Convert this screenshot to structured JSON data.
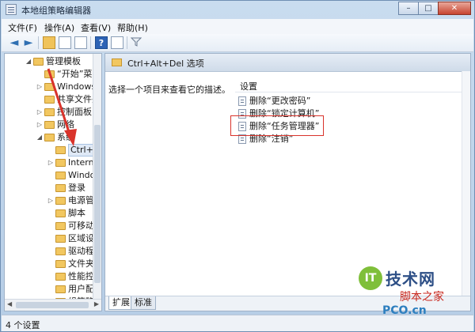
{
  "window": {
    "title": "本地组策略编辑器",
    "minimize": "–",
    "maximize": "□",
    "close": "✕"
  },
  "menu": [
    "文件(F)",
    "操作(A)",
    "查看(V)",
    "帮助(H)"
  ],
  "toolbar": {
    "back": "◄",
    "forward": "►",
    "help": "?"
  },
  "tree": [
    {
      "label": "管理模板",
      "exp": "◢"
    },
    {
      "label": "“开始”菜",
      "exp": ""
    },
    {
      "label": "Windows",
      "exp": "▷"
    },
    {
      "label": "共享文件夹",
      "exp": ""
    },
    {
      "label": "控制面板",
      "exp": "▷"
    },
    {
      "label": "网络",
      "exp": "▷"
    },
    {
      "label": "系统",
      "exp": "◢"
    },
    {
      "label": "Ctrl+A",
      "exp": ""
    },
    {
      "label": "Intern",
      "exp": "▷"
    },
    {
      "label": "Windo",
      "exp": ""
    },
    {
      "label": "登录",
      "exp": ""
    },
    {
      "label": "电源管",
      "exp": "▷"
    },
    {
      "label": "脚本",
      "exp": ""
    },
    {
      "label": "可移动",
      "exp": ""
    },
    {
      "label": "区域设",
      "exp": ""
    },
    {
      "label": "驱动程",
      "exp": ""
    },
    {
      "label": "文件夹",
      "exp": ""
    },
    {
      "label": "性能控",
      "exp": ""
    },
    {
      "label": "用户配",
      "exp": ""
    },
    {
      "label": "组策略",
      "exp": ""
    }
  ],
  "right": {
    "header": "Ctrl+Alt+Del 选项",
    "description": "选择一个项目来查看它的描述。",
    "column_header": "设置",
    "settings": [
      "删除“更改密码”",
      "删除“锁定计算机”",
      "删除“任务管理器”",
      "删除“注销”"
    ],
    "tabs": [
      "扩展",
      "标准"
    ]
  },
  "status": "4 个设置",
  "watermark": {
    "logo": "IT",
    "main": "技术网",
    "sub": "脚本之家",
    "url": "PCO.cn"
  },
  "colors": {
    "highlight": "#d9332b",
    "arrow": "#d9332b"
  }
}
